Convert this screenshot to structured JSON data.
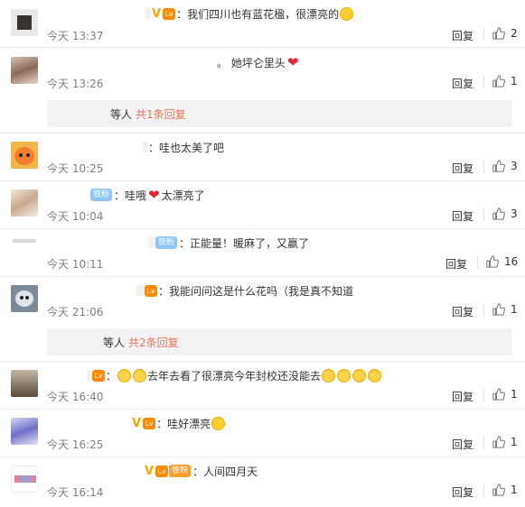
{
  "comments": [
    {
      "text": "：我们四川也有蓝花楹，很漂亮的",
      "time": "今天 13:37",
      "reply": "回复",
      "likes": "2"
    },
    {
      "text": "。 她坪仑里头",
      "time": "今天 13:26",
      "reply": "回复",
      "likes": "1"
    },
    {
      "text": "：哇也太美了吧",
      "time": "今天 10:25",
      "reply": "回复",
      "likes": "3"
    },
    {
      "text": "：哇哦",
      "text2": "太漂亮了",
      "fan": "铁粉",
      "time": "今天 10:04",
      "reply": "回复",
      "likes": "3"
    },
    {
      "text": "：正能量！暖麻了，又赢了",
      "fan": "铁粉",
      "time": "今天 10:11",
      "reply": "回复",
      "likes": "16"
    },
    {
      "text": "：我能问问这是什么花吗（我是真不知道",
      "time": "今天 21:06",
      "reply": "回复",
      "likes": "1"
    },
    {
      "text": "：",
      "text2": "去年去看了很漂亮今年封校还没能去",
      "time": "今天 16:40",
      "reply": "回复",
      "likes": "1"
    },
    {
      "text": "：哇好漂亮",
      "time": "今天 16:25",
      "reply": "回复",
      "likes": "1"
    },
    {
      "text": "：人间四月天",
      "fan": "铁粉",
      "time": "今天 16:14",
      "reply": "回复",
      "likes": "1"
    }
  ],
  "subreplies": [
    {
      "prefix": "等人",
      "more": "共1条回复"
    },
    {
      "prefix": "等人",
      "more": "共2条回复"
    }
  ],
  "icons": {
    "like": "thumbs-up-icon",
    "vip": "v-badge-icon",
    "level": "level-badge-icon"
  },
  "colors": {
    "accent": "#eb7350",
    "vip": "#f5a400",
    "fan_badge": "#8fc6f4",
    "heart": "#e8242f"
  }
}
